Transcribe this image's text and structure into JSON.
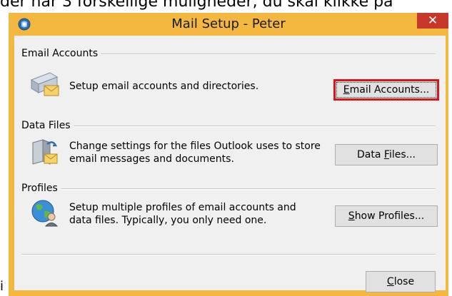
{
  "background_caption": "der har 3 forskellige muligheder, du skal klikke på",
  "background_glyph": "i",
  "window": {
    "title": "Mail Setup - Peter",
    "close_symbol": "✕",
    "colors": {
      "frame": "#f4b841",
      "close": "#c7382b",
      "highlight": "#d8141c",
      "client": "#f0f0f0"
    }
  },
  "sections": {
    "email": {
      "heading": "Email Accounts",
      "description": "Setup email accounts and directories.",
      "button": {
        "prefix": "",
        "mnemonic": "E",
        "rest": "mail Accounts..."
      },
      "icon": "email-accounts-icon"
    },
    "data": {
      "heading": "Data Files",
      "description": "Change settings for the files Outlook uses to store email messages and documents.",
      "button": {
        "prefix": "Data ",
        "mnemonic": "F",
        "rest": "iles..."
      },
      "icon": "data-files-icon"
    },
    "profiles": {
      "heading": "Profiles",
      "description": "Setup multiple profiles of email accounts and data files. Typically, you only need one.",
      "button": {
        "prefix": "",
        "mnemonic": "S",
        "rest": "how Profiles..."
      },
      "icon": "profiles-globe-icon"
    }
  },
  "footer": {
    "close_button": {
      "mnemonic": "C",
      "rest": "lose"
    }
  }
}
